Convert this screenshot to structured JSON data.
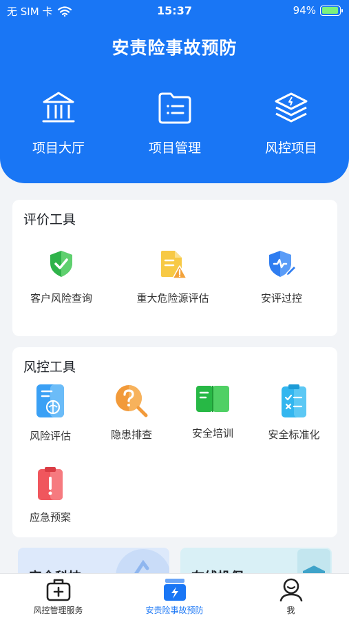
{
  "status_bar": {
    "carrier": "无 SIM 卡",
    "time": "15:37",
    "battery": "94%",
    "battery_level": 0.94
  },
  "header": {
    "title": "安责险事故预防",
    "nav": [
      {
        "label": "项目大厅",
        "icon": "hall-icon"
      },
      {
        "label": "项目管理",
        "icon": "folder-list-icon"
      },
      {
        "label": "风控项目",
        "icon": "layers-icon"
      }
    ]
  },
  "evaluation_tools": {
    "title": "评价工具",
    "items": [
      {
        "label": "客户风险查询",
        "icon": "shield-check-icon"
      },
      {
        "label": "重大危险源评估",
        "icon": "document-warning-icon"
      },
      {
        "label": "安评过控",
        "icon": "shield-edit-icon"
      }
    ]
  },
  "risk_tools": {
    "title": "风控工具",
    "items": [
      {
        "label": "风险评估",
        "icon": "risk-assessment-icon"
      },
      {
        "label": "隐患排查",
        "icon": "question-search-icon"
      },
      {
        "label": "安全培训",
        "icon": "book-icon"
      },
      {
        "label": "安全标准化",
        "icon": "checklist-icon"
      },
      {
        "label": "应急预案",
        "icon": "emergency-clipboard-icon"
      }
    ]
  },
  "promos": [
    {
      "label": "安全科技"
    },
    {
      "label": "在线投保"
    }
  ],
  "tabbar": {
    "tabs": [
      {
        "label": "风控管理服务",
        "icon": "medical-kit-icon",
        "active": false
      },
      {
        "label": "安责险事故预防",
        "icon": "lightning-box-icon",
        "active": true
      },
      {
        "label": "我",
        "icon": "user-icon",
        "active": false
      }
    ]
  },
  "colors": {
    "primary": "#1976f5",
    "background": "#f2f4f7",
    "card": "#ffffff"
  }
}
